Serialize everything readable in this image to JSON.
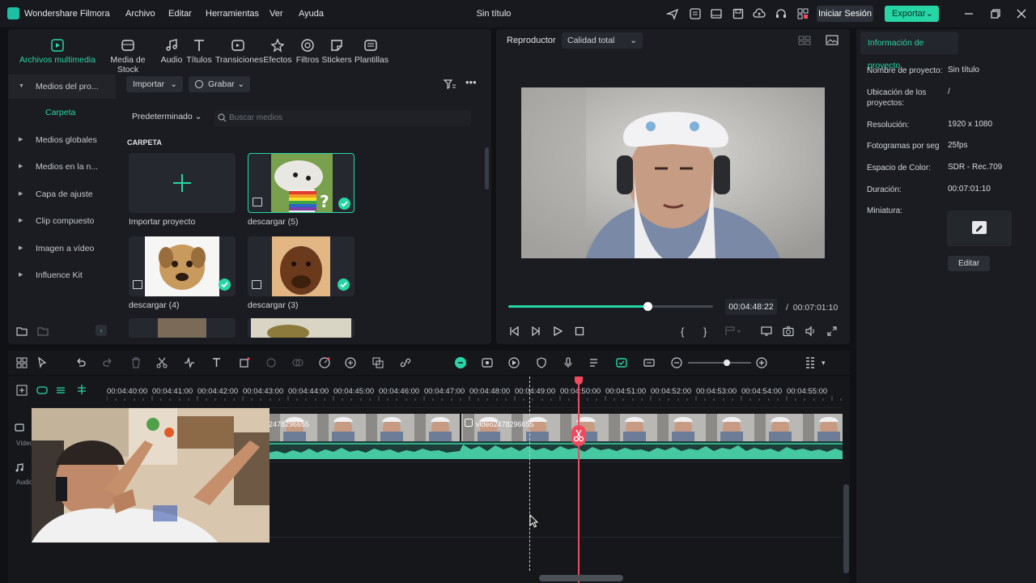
{
  "app": {
    "name": "Wondershare Filmora",
    "window_title": "Sin título",
    "menu": [
      "Archivo",
      "Editar",
      "Herramientas",
      "Ver",
      "Ayuda"
    ],
    "login_label": "Iniciar Sesión",
    "export_label": "Exportar",
    "accent_color": "#27d6a6",
    "playhead_color": "#ef4a5e"
  },
  "media_tabs": [
    {
      "label": "Archivos multimedia",
      "icon": "media-files-icon"
    },
    {
      "label": "Media de Stock",
      "icon": "stock-media-icon"
    },
    {
      "label": "Audio",
      "icon": "music-note-icon"
    },
    {
      "label": "Títulos",
      "icon": "text-title-icon"
    },
    {
      "label": "Transiciones",
      "icon": "transitions-icon"
    },
    {
      "label": "Efectos",
      "icon": "effects-icon"
    },
    {
      "label": "Filtros",
      "icon": "filters-icon"
    },
    {
      "label": "Stickers",
      "icon": "stickers-icon"
    },
    {
      "label": "Plantillas",
      "icon": "templates-icon"
    }
  ],
  "sidebar": {
    "project_media": "Medios del pro...",
    "folder": "Carpeta",
    "items": [
      "Medios globales",
      "Medios en la n...",
      "Capa de ajuste",
      "Clip compuesto",
      "Imagen a vídeo",
      "Influence Kit"
    ]
  },
  "media": {
    "import_label": "Importar",
    "record_label": "Grabar",
    "sort_label": "Predeterminado",
    "search_placeholder": "Buscar medios",
    "section_label": "CARPETA",
    "items": [
      {
        "label": "Importar proyecto"
      },
      {
        "label": "descargar (5)"
      },
      {
        "label": "descargar (4)"
      },
      {
        "label": "descargar (3)"
      }
    ]
  },
  "player": {
    "title": "Reproductor",
    "quality": "Calidad total",
    "current_time": "00:04:48:22",
    "separator": "/",
    "total_time": "00:07:01:10",
    "progress": 0.68
  },
  "info": {
    "tab": "Información de proyecto",
    "fields": [
      {
        "label": "Nombre de proyecto:",
        "value": "Sin título"
      },
      {
        "label": "Ubicación de los proyectos:",
        "value": "/"
      },
      {
        "label": "Resolución:",
        "value": "1920 x 1080"
      },
      {
        "label": "Fotogramas por seg",
        "value": "25fps"
      },
      {
        "label": "Espacio de Color:",
        "value": "SDR - Rec.709"
      },
      {
        "label": "Duración:",
        "value": "00:07:01:10"
      },
      {
        "label": "Miniatura:",
        "value": ""
      }
    ],
    "edit_label": "Editar"
  },
  "timeline": {
    "ruler": [
      "00:04:40:00",
      "00:04:41:00",
      "00:04:42:00",
      "00:04:43:00",
      "00:04:44:00",
      "00:04:45:00",
      "00:04:46:00",
      "00:04:47:00",
      "00:04:48:00",
      "00:04:49:00",
      "00:04:50:00",
      "00:04:51:00",
      "00:04:52:00",
      "00:04:53:00",
      "00:04:54:00",
      "00:04:55:00"
    ],
    "clip_a_label": "2478296655",
    "clip_b_label": "video2478296655",
    "video_track_label": "Vídeo 1",
    "audio_track_label": "Audio 1"
  }
}
